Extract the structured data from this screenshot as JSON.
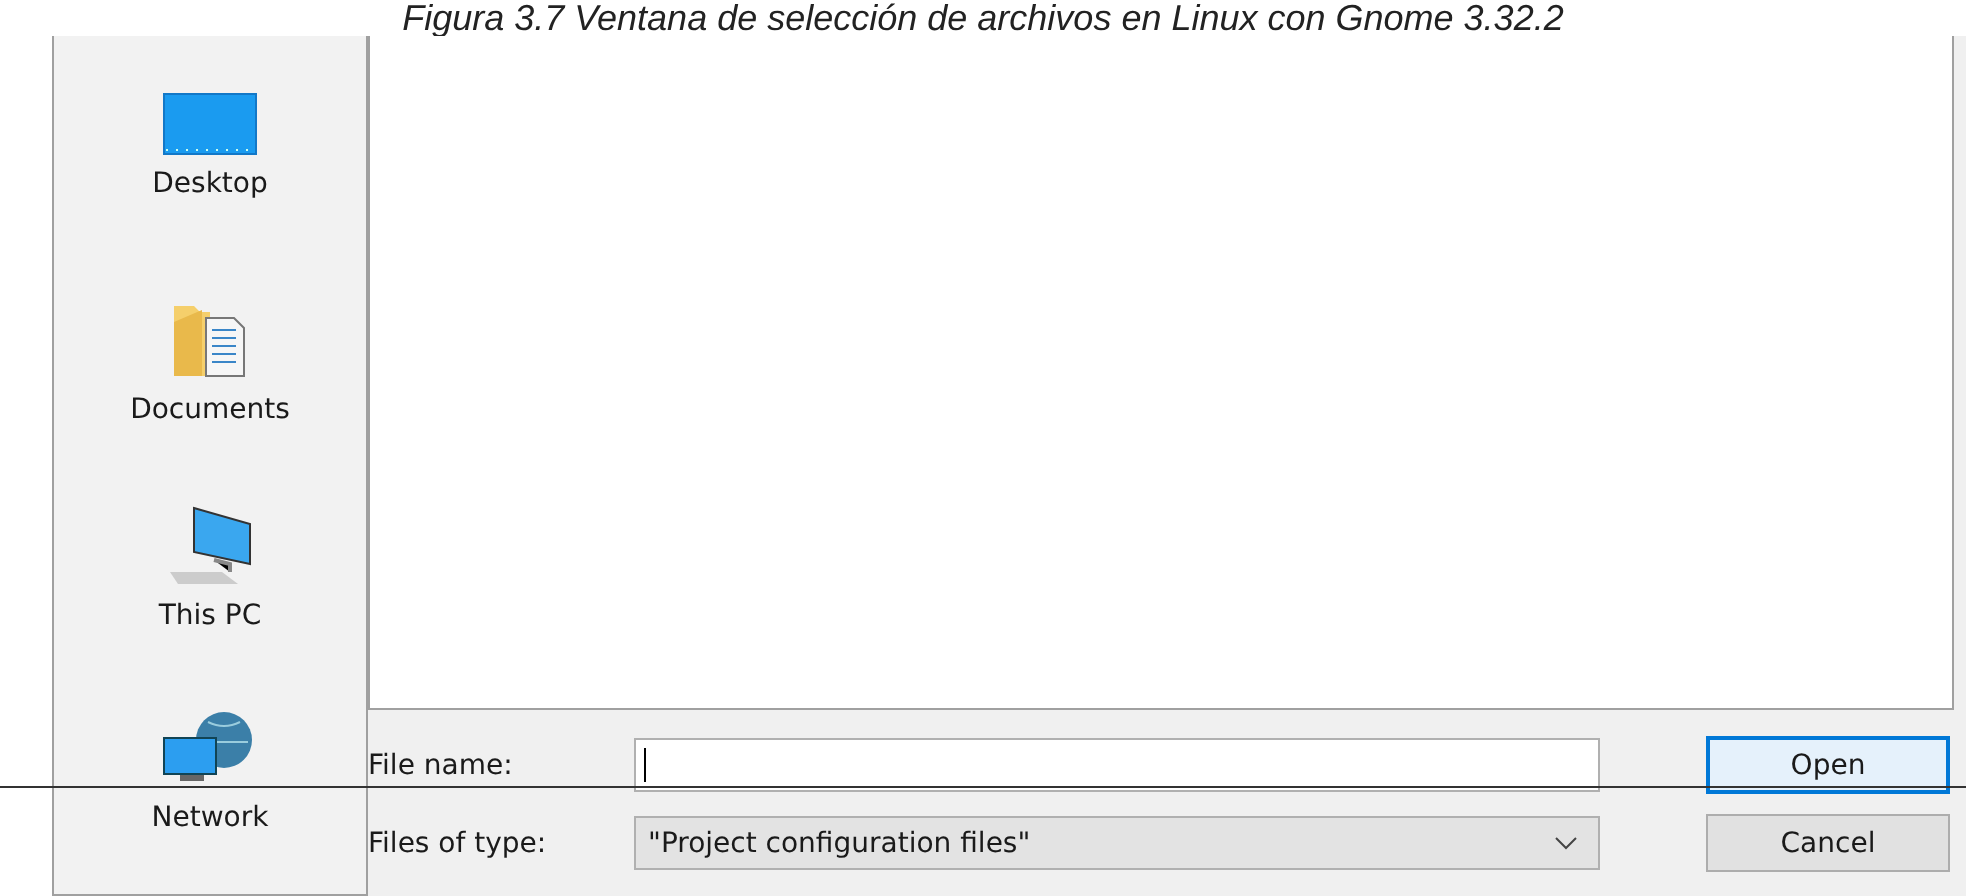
{
  "caption": "Figura 3.7 Ventana de selección de archivos en Linux con Gnome 3.32.2",
  "sidebar": {
    "items": [
      {
        "label": "Desktop",
        "kind": "desktop"
      },
      {
        "label": "Documents",
        "kind": "documents"
      },
      {
        "label": "This PC",
        "kind": "pc"
      },
      {
        "label": "Network",
        "kind": "network"
      }
    ]
  },
  "file_name": {
    "label": "File name:"
  },
  "file_type": {
    "label": "Files of type:",
    "value": "\"Project configuration files\""
  },
  "buttons": [
    {
      "label": "Open",
      "focused": true
    },
    {
      "label": "Cancel",
      "focused": false
    }
  ]
}
